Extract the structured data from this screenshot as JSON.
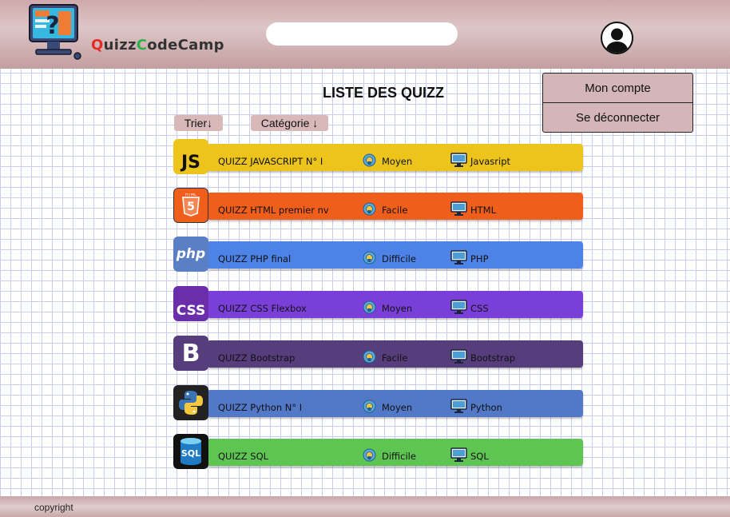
{
  "header": {
    "brand": {
      "q": "Q",
      "uizz": "uizz",
      "c": "C",
      "odecamp": "odeCamp"
    },
    "search": {
      "placeholder": "",
      "value": ""
    }
  },
  "account_menu": {
    "items": [
      {
        "label": "Mon compte"
      },
      {
        "label": "Se déconnecter"
      }
    ]
  },
  "main": {
    "title": "LISTE DES QUIZZ",
    "sort_label": "Trier↓",
    "category_label": "Catégorie ↓",
    "quizzes": [
      {
        "title": "QUIZZ JAVASCRIPT N° I",
        "difficulty": "Moyen",
        "category": "Javasript",
        "color": "#edc41c",
        "logo": "js-logo"
      },
      {
        "title": "QUIZZ HTML premier nv",
        "difficulty": "Facile",
        "category": "HTML",
        "color": "#f05e1c",
        "logo": "html5-logo"
      },
      {
        "title": "QUIZZ PHP final",
        "difficulty": "Difficile",
        "category": "PHP",
        "color": "#4d82e6",
        "logo": "php-logo"
      },
      {
        "title": "QUIZZ CSS Flexbox",
        "difficulty": "Moyen",
        "category": "CSS",
        "color": "#7b3fd9",
        "logo": "css-logo"
      },
      {
        "title": "QUIZZ Bootstrap",
        "difficulty": "Facile",
        "category": "Bootstrap",
        "color": "#563d7c",
        "logo": "bootstrap-logo"
      },
      {
        "title": "QUIZZ Python N° I",
        "difficulty": "Moyen",
        "category": "Python",
        "color": "#5278c8",
        "logo": "python-logo"
      },
      {
        "title": "QUIZZ SQL",
        "difficulty": "Difficile",
        "category": "SQL",
        "color": "#5fc552",
        "logo": "sql-logo"
      }
    ]
  },
  "footer": {
    "copyright": "copyright"
  },
  "logo_text": {
    "js": "JS",
    "html": "HTML",
    "html5": "5",
    "php": "php",
    "css": "CSS",
    "bootstrap": "B",
    "sql": "SQL"
  }
}
